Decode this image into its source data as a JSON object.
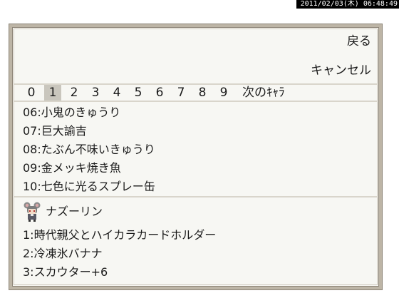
{
  "timestamp": "2011/02/03(木) 06:48:49",
  "menu": {
    "back_label": "戻る",
    "cancel_label": "キャンセル"
  },
  "tabs": {
    "pages": [
      "0",
      "1",
      "2",
      "3",
      "4",
      "5",
      "6",
      "7",
      "8",
      "9"
    ],
    "selected": "1",
    "next_label": "次のｷｬﾗ"
  },
  "items": [
    "06:小鬼のきゅうり",
    "07:巨大諭吉",
    "08:たぶん不味いきゅうり",
    "09:金メッキ焼き魚",
    "10:七色に光るスプレー缶"
  ],
  "character": {
    "name": "ナズーリン",
    "avatar_icon": "mouse-girl-sprite-icon",
    "equipment": [
      "1:時代親父とハイカラカードホルダー",
      "2:冷凍氷バナナ",
      "3:スカウター+6"
    ]
  },
  "colors": {
    "panel_bg": "#f7f7f3",
    "frame": "#bdb5a6",
    "selected_tab": "#c9c6bd",
    "divider": "#d9d5cb"
  }
}
